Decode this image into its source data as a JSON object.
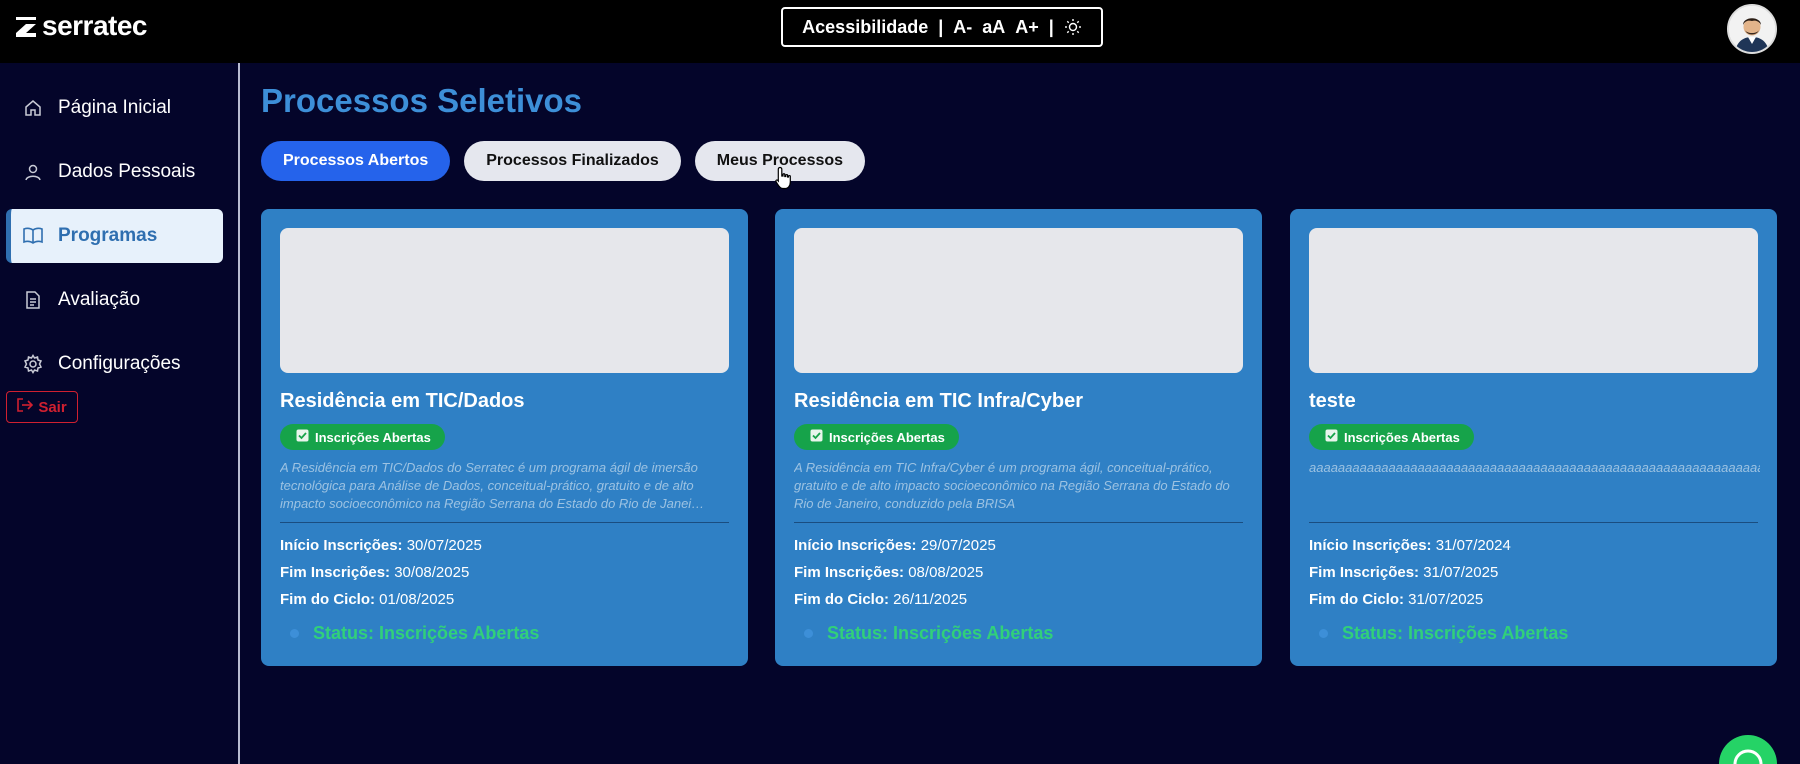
{
  "app": {
    "logo_text": "serratec"
  },
  "accessibility": {
    "label": "Acessibilidade",
    "sep": "|",
    "decrease": "A-",
    "normal": "aA",
    "increase": "A+",
    "theme_icon": "sun-icon"
  },
  "sidebar": {
    "items": [
      {
        "label": "Página Inicial",
        "icon": "home-icon"
      },
      {
        "label": "Dados Pessoais",
        "icon": "user-icon"
      },
      {
        "label": "Programas",
        "icon": "book-icon",
        "active": true
      },
      {
        "label": "Avaliação",
        "icon": "document-icon"
      },
      {
        "label": "Configurações",
        "icon": "gear-icon"
      }
    ],
    "logout_label": "Sair"
  },
  "main": {
    "title": "Processos Seletivos",
    "tabs": [
      {
        "label": "Processos Abertos",
        "active": true
      },
      {
        "label": "Processos Finalizados"
      },
      {
        "label": "Meus Processos"
      }
    ]
  },
  "cards": [
    {
      "title": "Residência em TIC/Dados",
      "badge": "Inscrições Abertas",
      "description": "A Residência em TIC/Dados do Serratec é um programa ágil de imersão tecnológica para Análise de Dados, conceitual-prático, gratuito e de alto impacto socioeconômico na Região Serrana do Estado do Rio de Janei…",
      "inicio_label": "Início Inscrições:",
      "inicio": "30/07/2025",
      "fim_label": "Fim Inscrições:",
      "fim": "30/08/2025",
      "ciclo_label": "Fim do Ciclo:",
      "ciclo": "01/08/2025",
      "status": "Status: Inscrições Abertas"
    },
    {
      "title": "Residência em TIC Infra/Cyber",
      "badge": "Inscrições Abertas",
      "description": "A Residência em TIC Infra/Cyber é um programa ágil, conceitual-prático, gratuito e de alto impacto socioeconômico na Região Serrana do Estado do Rio de Janeiro, conduzido pela BRISA",
      "inicio_label": "Início Inscrições:",
      "inicio": "29/07/2025",
      "fim_label": "Fim Inscrições:",
      "fim": "08/08/2025",
      "ciclo_label": "Fim do Ciclo:",
      "ciclo": "26/11/2025",
      "status": "Status: Inscrições Abertas"
    },
    {
      "title": "teste",
      "badge": "Inscrições Abertas",
      "description": "aaaaaaaaaaaaaaaaaaaaaaaaaaaaaaaaaaaaaaaaaaaaaaaaaaaaaaaaaaaaaaa",
      "inicio_label": "Início Inscrições:",
      "inicio": "31/07/2024",
      "fim_label": "Fim Inscrições:",
      "fim": "31/07/2025",
      "ciclo_label": "Fim do Ciclo:",
      "ciclo": "31/07/2025",
      "status": "Status: Inscrições Abertas"
    }
  ],
  "colors": {
    "background": "#04052a",
    "accent": "#2563eb",
    "card": "#2f80c5",
    "success": "#16a34a",
    "status_text": "#31d07a",
    "logout": "#d02030"
  }
}
